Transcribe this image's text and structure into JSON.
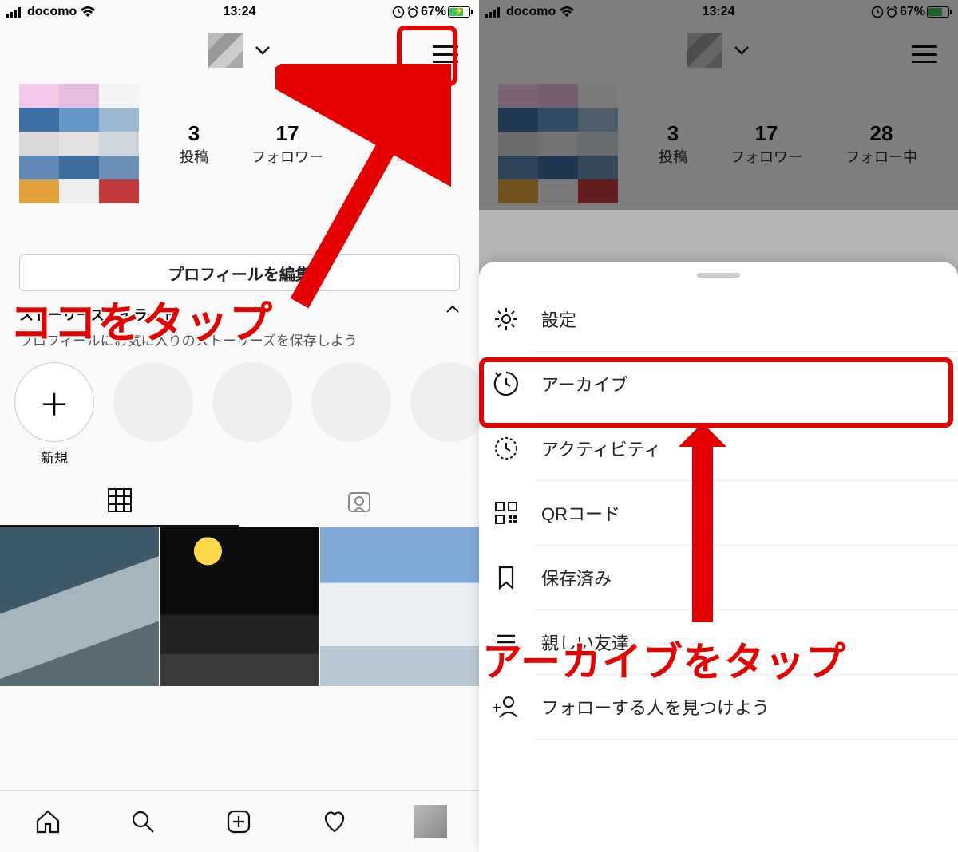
{
  "status": {
    "carrier": "docomo",
    "time": "13:24",
    "battery_pct": "67%"
  },
  "header": {
    "username_pixelated": true
  },
  "stats": {
    "posts": {
      "num": "3",
      "label": "投稿"
    },
    "followers": {
      "num": "17",
      "label": "フォロワー"
    },
    "following": {
      "num": "28",
      "label": "フォロー中"
    }
  },
  "edit_profile_label": "プロフィールを編集",
  "highlights": {
    "title": "ストーリーズハイライト",
    "subtitle": "プロフィールにお気に入りのストーリーズを保存しよう",
    "new_label": "新規"
  },
  "menu": {
    "settings": "設定",
    "archive": "アーカイブ",
    "activity": "アクティビティ",
    "qr": "QRコード",
    "saved": "保存済み",
    "close_friends": "親しい友達",
    "discover": "フォローする人を見つけよう"
  },
  "annotations": {
    "tap_here": "ココをタップ",
    "tap_archive": "アーカイブをタップ"
  }
}
